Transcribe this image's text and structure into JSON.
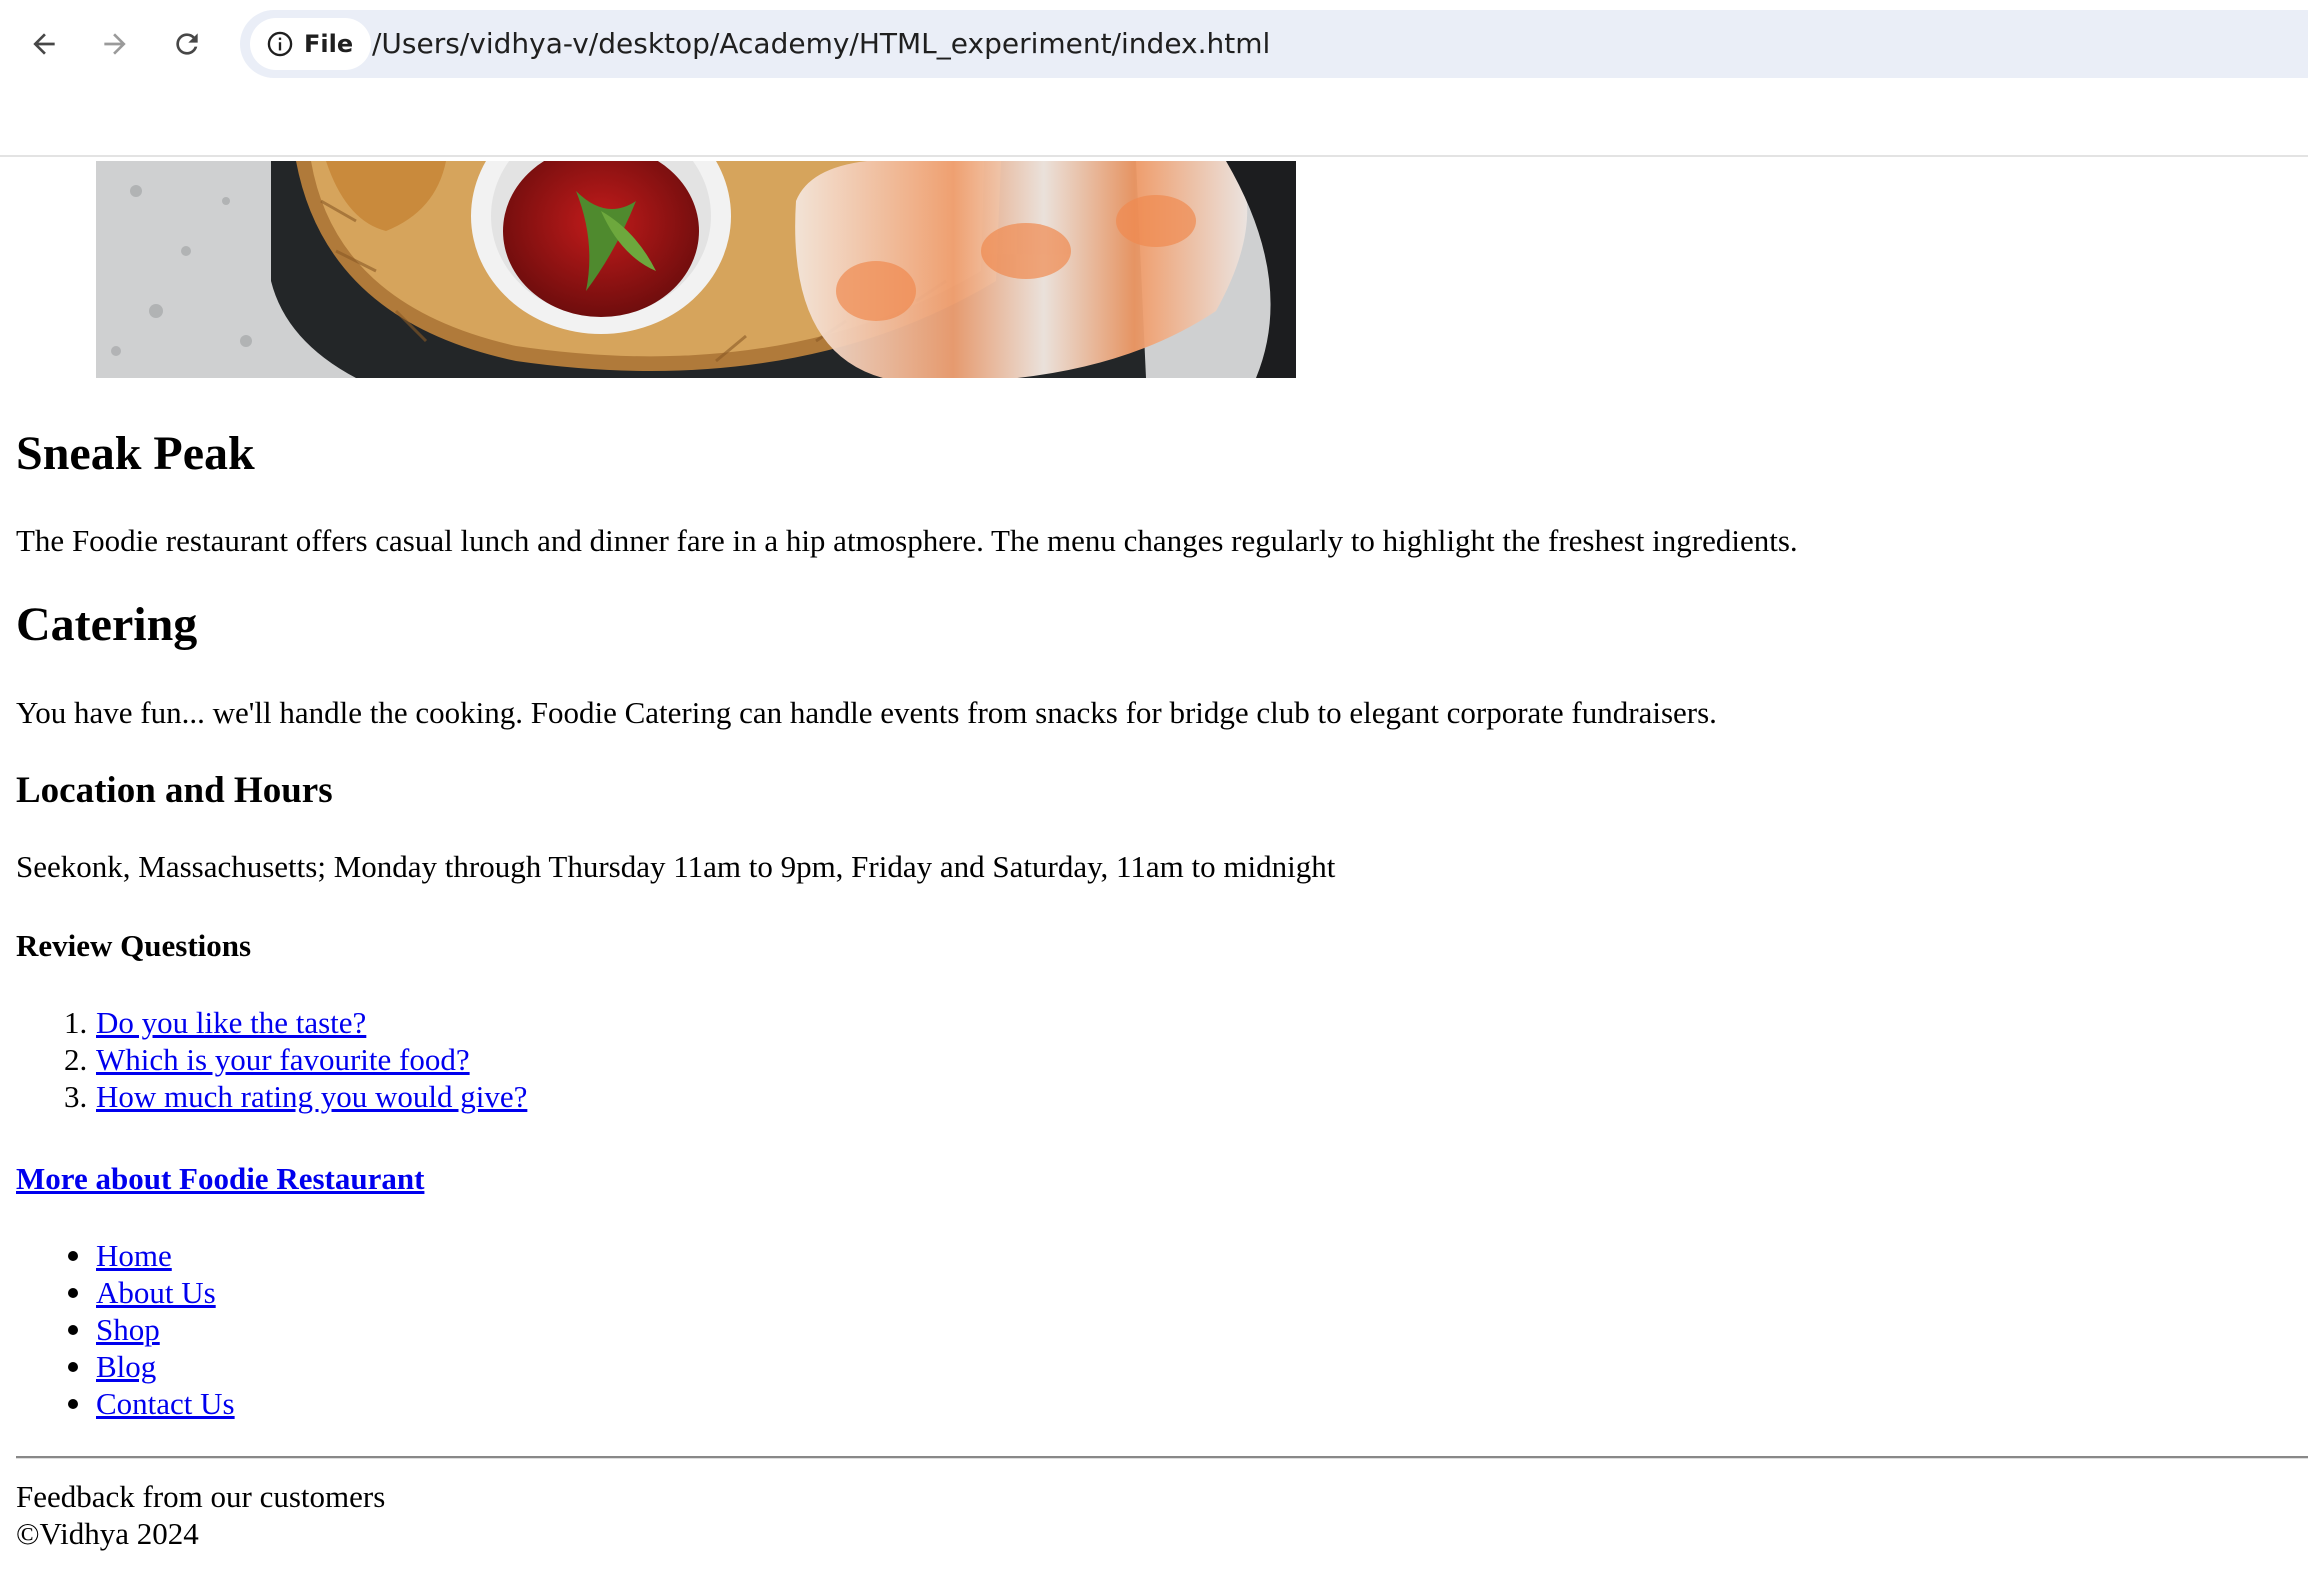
{
  "browser": {
    "back_icon": "arrow-left-icon",
    "forward_icon": "arrow-right-icon",
    "reload_icon": "reload-icon",
    "chip_label": "File",
    "chip_icon": "info-icon",
    "url": "/Users/vidhya-v/desktop/Academy/HTML_experiment/index.html"
  },
  "hero": {
    "image": "spring-rolls-with-dipping-sauce-photo"
  },
  "sections": {
    "sneak_peak": {
      "heading": "Sneak Peak",
      "text": "The Foodie restaurant offers casual lunch and dinner fare in a hip atmosphere. The menu changes regularly to highlight the freshest ingredients."
    },
    "catering": {
      "heading": "Catering",
      "text": "You have fun... we'll handle the cooking. Foodie Catering can handle events from snacks for bridge club to elegant corporate fundraisers."
    },
    "location": {
      "heading": "Location and Hours",
      "text": "Seekonk, Massachusetts; Monday through Thursday 11am to 9pm, Friday and Saturday, 11am to midnight"
    },
    "review": {
      "heading": "Review Questions",
      "items": [
        {
          "num": "1.",
          "label": "Do you like the taste?"
        },
        {
          "num": "2.",
          "label": "Which is your favourite food?"
        },
        {
          "num": "3.",
          "label": "How much rating you would give?"
        }
      ]
    },
    "more": {
      "link": "More about Foodie Restaurant"
    },
    "nav": {
      "items": [
        "Home",
        "About Us",
        "Shop",
        "Blog",
        "Contact Us"
      ]
    }
  },
  "footer": {
    "feedback": "Feedback from our customers",
    "copyright": "©Vidhya 2024"
  },
  "colors": {
    "link": "#0000ee",
    "omnibox": "#eaeef7"
  }
}
